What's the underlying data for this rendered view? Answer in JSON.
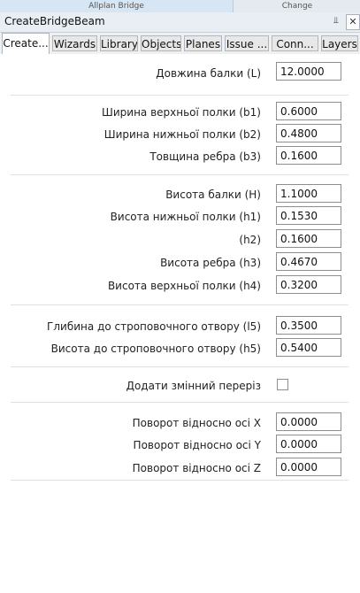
{
  "ribbon": {
    "segment1": "Allplan Bridge",
    "segment2": "Change"
  },
  "window": {
    "title": "CreateBridgeBeam",
    "pin_glyph": "⫫",
    "close_glyph": "✕"
  },
  "tabs": [
    {
      "label": "Create...",
      "active": true
    },
    {
      "label": "Wizards",
      "active": false
    },
    {
      "label": "Library",
      "active": false
    },
    {
      "label": "Objects",
      "active": false
    },
    {
      "label": "Planes",
      "active": false
    },
    {
      "label": "Issue ...",
      "active": false
    },
    {
      "label": "Conn...",
      "active": false
    },
    {
      "label": "Layers",
      "active": false
    }
  ],
  "fields": {
    "length": {
      "label": "Довжина балки (L)",
      "value": "12.0000"
    },
    "b1": {
      "label": "Ширина верхньої полки (b1)",
      "value": "0.6000"
    },
    "b2": {
      "label": "Ширина нижньої полки (b2)",
      "value": "0.4800"
    },
    "b3": {
      "label": "Товщина ребра (b3)",
      "value": "0.1600"
    },
    "H": {
      "label": "Висота балки (H)",
      "value": "1.1000"
    },
    "h1": {
      "label": "Висота нижньої полки (h1)",
      "value": "0.1530"
    },
    "h2": {
      "label": "(h2)",
      "value": "0.1600"
    },
    "h3": {
      "label": "Висота ребра (h3)",
      "value": "0.4670"
    },
    "h4": {
      "label": "Висота верхньої полки (h4)",
      "value": "0.3200"
    },
    "l5": {
      "label": "Глибина до строповочного отвору (l5)",
      "value": "0.3500"
    },
    "h5": {
      "label": "Висота до строповочного отвору (h5)",
      "value": "0.5400"
    },
    "variable_section": {
      "label": "Додати змінний переріз",
      "checked": false
    },
    "rot_x": {
      "label": "Поворот відносно осі X",
      "value": "0.0000"
    },
    "rot_y": {
      "label": "Поворот відносно осі Y",
      "value": "0.0000"
    },
    "rot_z": {
      "label": "Поворот відносно осі Z",
      "value": "0.0000"
    }
  }
}
